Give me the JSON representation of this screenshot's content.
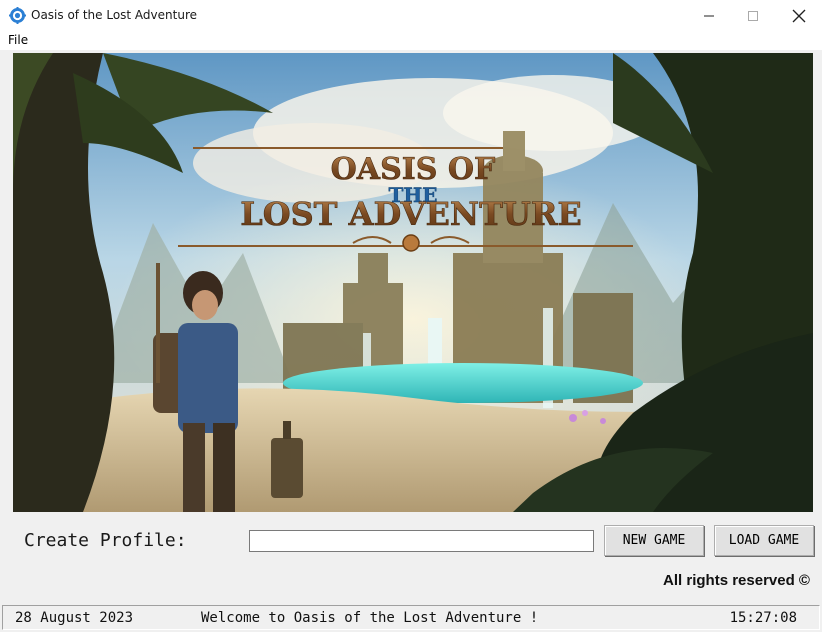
{
  "window": {
    "title": "Oasis of the Lost Adventure",
    "app_icon": "gear-globe-icon",
    "controls": [
      "minimize-icon",
      "maximize-icon",
      "close-icon"
    ]
  },
  "menu": {
    "file_label": "File"
  },
  "banner": {
    "title_line1": "OASIS OF",
    "title_line2": "THE",
    "title_line3": "LOST ADVENTURE",
    "colors": {
      "sky": "#9cc6e0",
      "cloud": "#f4efe2",
      "water": "#4fd6d0",
      "sand": "#d8c7a3",
      "foliage": "#2f3a22",
      "title_bronze": "#8a5a2b",
      "title_blue": "#1f5f9e"
    }
  },
  "profile": {
    "label": "Create Profile:",
    "value": "",
    "new_game_label": "NEW GAME",
    "load_game_label": "LOAD GAME"
  },
  "footer": {
    "rights": "All rights reserved ©"
  },
  "statusbar": {
    "date": "28 August 2023",
    "message": "Welcome to Oasis of the Lost Adventure !",
    "time": "15:27:08"
  }
}
